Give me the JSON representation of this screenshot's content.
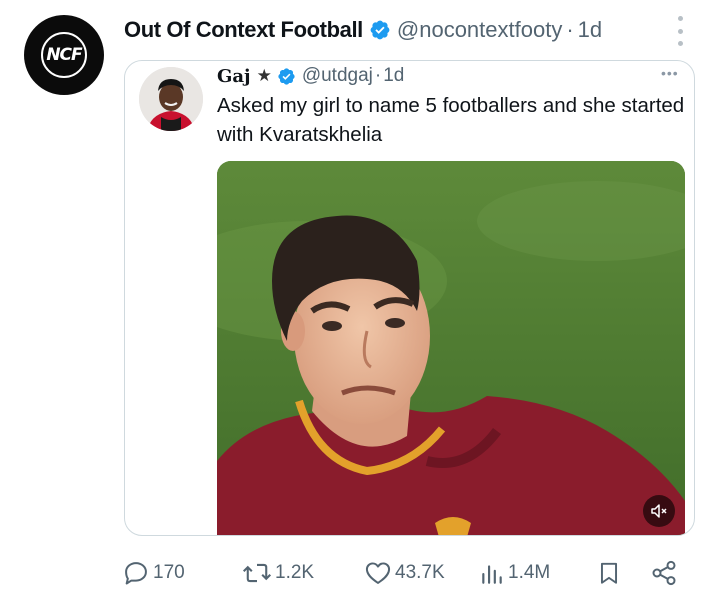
{
  "tweet": {
    "author_name": "Out Of Context Football",
    "handle": "@nocontextfooty",
    "separator": "·",
    "time": "1d",
    "avatar_logo": "NCF",
    "verified_icon": "verified-badge-icon",
    "more_icon": "vertical-more-icon"
  },
  "quote": {
    "author_name": "Gaj",
    "star": "★",
    "handle": "@utdgaj",
    "separator": "·",
    "time": "1d",
    "text": "Asked my girl to name 5 footballers and she started with Kvaratskhelia",
    "more": "•••",
    "media_controls": {
      "mute_icon": "volume-mute-icon"
    }
  },
  "actions": {
    "reply_count": "170",
    "retweet_count": "1.2K",
    "like_count": "43.7K",
    "view_count": "1.4M",
    "icons": [
      "reply-icon",
      "retweet-icon",
      "like-icon",
      "views-icon",
      "bookmark-icon",
      "share-icon"
    ]
  },
  "colors": {
    "verified": "#1d9bf0",
    "secondary_text": "#536471",
    "border": "#cfd9de",
    "jersey": "#8a1c2c"
  }
}
